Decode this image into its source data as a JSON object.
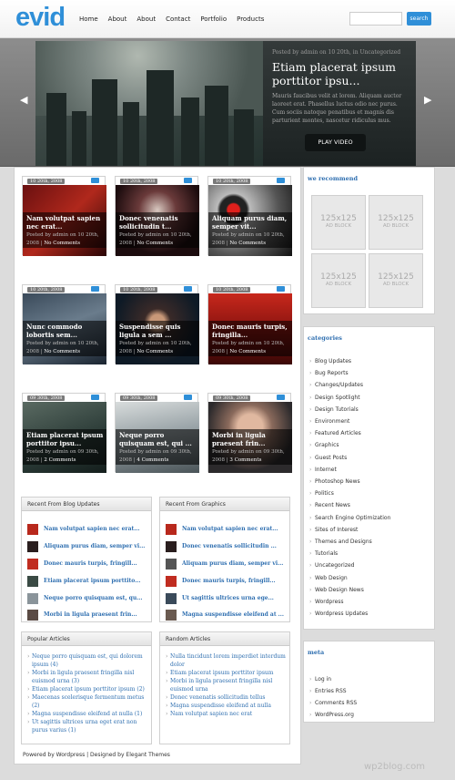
{
  "header": {
    "logo": "evid",
    "nav": [
      "Home",
      "About",
      "About",
      "Contact",
      "Portfolio",
      "Products"
    ],
    "search_label": "search"
  },
  "featured": {
    "meta": "Posted by admin on 10 20th, in Uncategorized",
    "title": "Etiam placerat ipsum porttitor ipsu...",
    "excerpt": "Mauris faucibus velit at lorem. Aliquam auctor laoreet erat. Phasellus luctus odio nec purus. Cum sociis natoque penatibus et magnis dis parturient montes, nascetur ridiculus mus.",
    "play_label": "PLAY VIDEO"
  },
  "cards": [
    {
      "date": "10 20th, 2008",
      "title": "Nam volutpat sapien nec erat...",
      "meta": "Posted by admin on 10 20th, 2008 |",
      "comments": "No Comments"
    },
    {
      "date": "10 20th, 2008",
      "title": "Donec venenatis sollicitudin t...",
      "meta": "Posted by admin on 10 20th, 2008 |",
      "comments": "No Comments"
    },
    {
      "date": "10 20th, 2008",
      "title": "Aliquam purus diam, semper vit...",
      "meta": "Posted by admin on 10 20th, 2008 |",
      "comments": "No Comments"
    },
    {
      "date": "10 20th, 2008",
      "title": "Nunc commodo lobortis sem...",
      "meta": "Posted by admin on 10 20th, 2008 |",
      "comments": "No Comments"
    },
    {
      "date": "10 20th, 2008",
      "title": "Suspendisse quis ligula a sem ...",
      "meta": "Posted by admin on 10 20th, 2008 |",
      "comments": "No Comments"
    },
    {
      "date": "10 20th, 2008",
      "title": "Donec mauris turpis, fringilla...",
      "meta": "Posted by admin on 10 20th, 2008 |",
      "comments": "No Comments"
    },
    {
      "date": "09 30th, 2008",
      "title": "Etiam placerat ipsum porttitor ipsu...",
      "meta": "Posted by admin on 09 30th, 2008 |",
      "comments": "2 Comments"
    },
    {
      "date": "09 30th, 2008",
      "title": "Neque porro quisquam est, qui ...",
      "meta": "Posted by admin on 09 30th, 2008 |",
      "comments": "4 Comments"
    },
    {
      "date": "09 30th, 2008",
      "title": "Morbi in ligula praesent frin...",
      "meta": "Posted by admin on 09 30th, 2008 |",
      "comments": "3 Comments"
    }
  ],
  "recent_blog": {
    "title": "Recent From Blog Updates",
    "items": [
      "Nam volutpat sapien nec erat...",
      "Aliquam purus diam, semper vi...",
      "Donec mauris turpis, fringill...",
      "Etiam placerat ipsum porttito...",
      "Neque porro quisquam est, qu...",
      "Morbi in ligula praesent frin..."
    ]
  },
  "recent_graphics": {
    "title": "Recent From Graphics",
    "items": [
      "Nam volutpat sapien nec erat...",
      "Donec venenatis sollicitudin ...",
      "Aliquam purus diam, semper vi...",
      "Donec mauris turpis, fringill...",
      "Ut sagittis ultrices urna ege...",
      "Magna suspendisse eleifend at ..."
    ]
  },
  "popular": {
    "title": "Popular Articles",
    "items": [
      "Neque porro quisquam est, qui dolorem ipsum (4)",
      "Morbi in ligula praesent fringilla nisl euismod urna (3)",
      "Etiam placerat ipsum porttitor ipsum (2)",
      "Maecenas scelerisque fermentum metus (2)",
      "Magna suspendisse eleifend at nulla (1)",
      "Ut sagittis ultrices urna eget erat non purus varius (1)"
    ]
  },
  "random": {
    "title": "Random Articles",
    "items": [
      "Nulla tincidunt lorem imperdiet interdum dolor",
      "Etiam placerat ipsum porttitor ipsum",
      "Morbi in ligula praesent fringilla nisl euismod urna",
      "Donec venenatis sollicitudin tellus",
      "Magna suspendisse eleifend at nulla",
      "Nam volutpat sapien nec erat"
    ]
  },
  "sidebar": {
    "recommend_title": "we recommend",
    "ad_size": "125x125",
    "ad_label": "AD BLOCK",
    "categories_title": "categories",
    "categories": [
      "Blog Updates",
      "Bug Reports",
      "Changes/Updates",
      "Design Spotlight",
      "Design Tutorials",
      "Environment",
      "Featured Articles",
      "Graphics",
      "Guest Posts",
      "Internet",
      "Photoshop News",
      "Politics",
      "Recent News",
      "Search Engine Optimization",
      "Sites of Interest",
      "Themes and Designs",
      "Tutorials",
      "Uncategorized",
      "Web Design",
      "Web Design News",
      "Wordpress",
      "Wordpress Updates"
    ],
    "meta_title": "meta",
    "meta": [
      "Log in",
      "Entries RSS",
      "Comments RSS",
      "WordPress.org"
    ]
  },
  "footer": "Powered by Wordpress | Designed by Elegant Themes",
  "watermark": "wp2blog.com",
  "colors": {
    "accent": "#2f8fd8",
    "link": "#2f6fb0"
  }
}
